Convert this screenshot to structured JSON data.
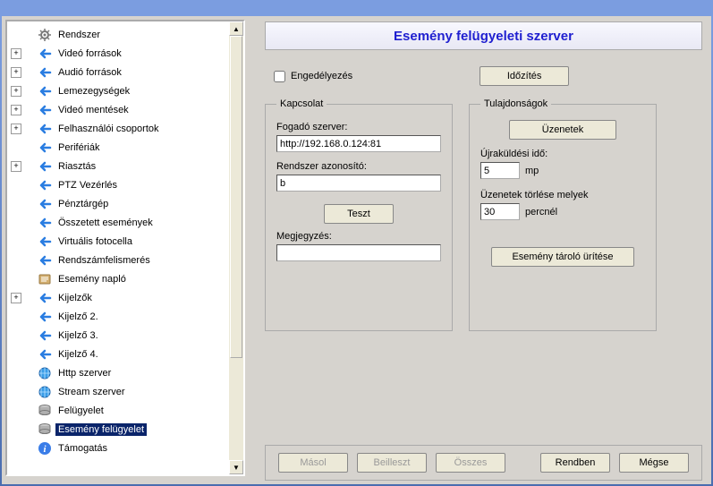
{
  "header": {
    "title": "Esemény felügyeleti szerver"
  },
  "enable": {
    "label": "Engedélyezés",
    "checked": false
  },
  "timing_btn": "Időzítés",
  "kapcsolat": {
    "legend": "Kapcsolat",
    "host_label": "Fogadó szerver:",
    "host_value": "http://192.168.0.124:81",
    "sysid_label": "Rendszer azonosító:",
    "sysid_value": "b",
    "test_btn": "Teszt",
    "note_label": "Megjegyzés:",
    "note_value": ""
  },
  "tulajd": {
    "legend": "Tulajdonságok",
    "messages_btn": "Üzenetek",
    "resend_label": "Újraküldési idő:",
    "resend_value": "5",
    "resend_unit": "mp",
    "deleteolder_label": "Üzenetek törlése melyek",
    "deleteolder_value": "30",
    "deleteolder_unit": "percnél",
    "flush_btn": "Esemény tároló ürítése"
  },
  "bottom": {
    "copy": "Másol",
    "paste": "Beilleszt",
    "all": "Összes",
    "ok": "Rendben",
    "cancel": "Mégse"
  },
  "tree": [
    {
      "toggle": "",
      "icon": "gear",
      "label": "Rendszer",
      "indent": 1
    },
    {
      "toggle": "+",
      "icon": "arrow-l",
      "label": "Videó források",
      "indent": 1
    },
    {
      "toggle": "+",
      "icon": "arrow-l",
      "label": "Audió források",
      "indent": 1
    },
    {
      "toggle": "+",
      "icon": "arrow-l",
      "label": "Lemezegységek",
      "indent": 1
    },
    {
      "toggle": "+",
      "icon": "arrow-l",
      "label": "Videó mentések",
      "indent": 1
    },
    {
      "toggle": "+",
      "icon": "arrow-l",
      "label": "Felhasználói csoportok",
      "indent": 1
    },
    {
      "toggle": "",
      "icon": "arrow-l",
      "label": "Perifériák",
      "indent": 1
    },
    {
      "toggle": "+",
      "icon": "arrow-l",
      "label": "Riasztás",
      "indent": 1
    },
    {
      "toggle": "",
      "icon": "arrow-l",
      "label": "PTZ Vezérlés",
      "indent": 1
    },
    {
      "toggle": "",
      "icon": "arrow-l",
      "label": "Pénztárgép",
      "indent": 1
    },
    {
      "toggle": "",
      "icon": "arrow-l",
      "label": "Összetett események",
      "indent": 1
    },
    {
      "toggle": "",
      "icon": "arrow-l",
      "label": "Virtuális fotocella",
      "indent": 1
    },
    {
      "toggle": "",
      "icon": "arrow-l",
      "label": "Rendszámfelismerés",
      "indent": 1
    },
    {
      "toggle": "",
      "icon": "log",
      "label": "Esemény napló",
      "indent": 1
    },
    {
      "toggle": "+",
      "icon": "arrow-l",
      "label": "Kijelzők",
      "indent": 1
    },
    {
      "toggle": "",
      "icon": "arrow-l",
      "label": "Kijelző 2.",
      "indent": 1
    },
    {
      "toggle": "",
      "icon": "arrow-l",
      "label": "Kijelző 3.",
      "indent": 1
    },
    {
      "toggle": "",
      "icon": "arrow-l",
      "label": "Kijelző 4.",
      "indent": 1
    },
    {
      "toggle": "",
      "icon": "globe",
      "label": "Http szerver",
      "indent": 1
    },
    {
      "toggle": "",
      "icon": "globe",
      "label": "Stream szerver",
      "indent": 1
    },
    {
      "toggle": "",
      "icon": "server",
      "label": "Felügyelet",
      "indent": 1
    },
    {
      "toggle": "",
      "icon": "server",
      "label": "Esemény felügyelet",
      "indent": 1,
      "selected": true
    },
    {
      "toggle": "",
      "icon": "info",
      "label": "Támogatás",
      "indent": 1
    }
  ]
}
